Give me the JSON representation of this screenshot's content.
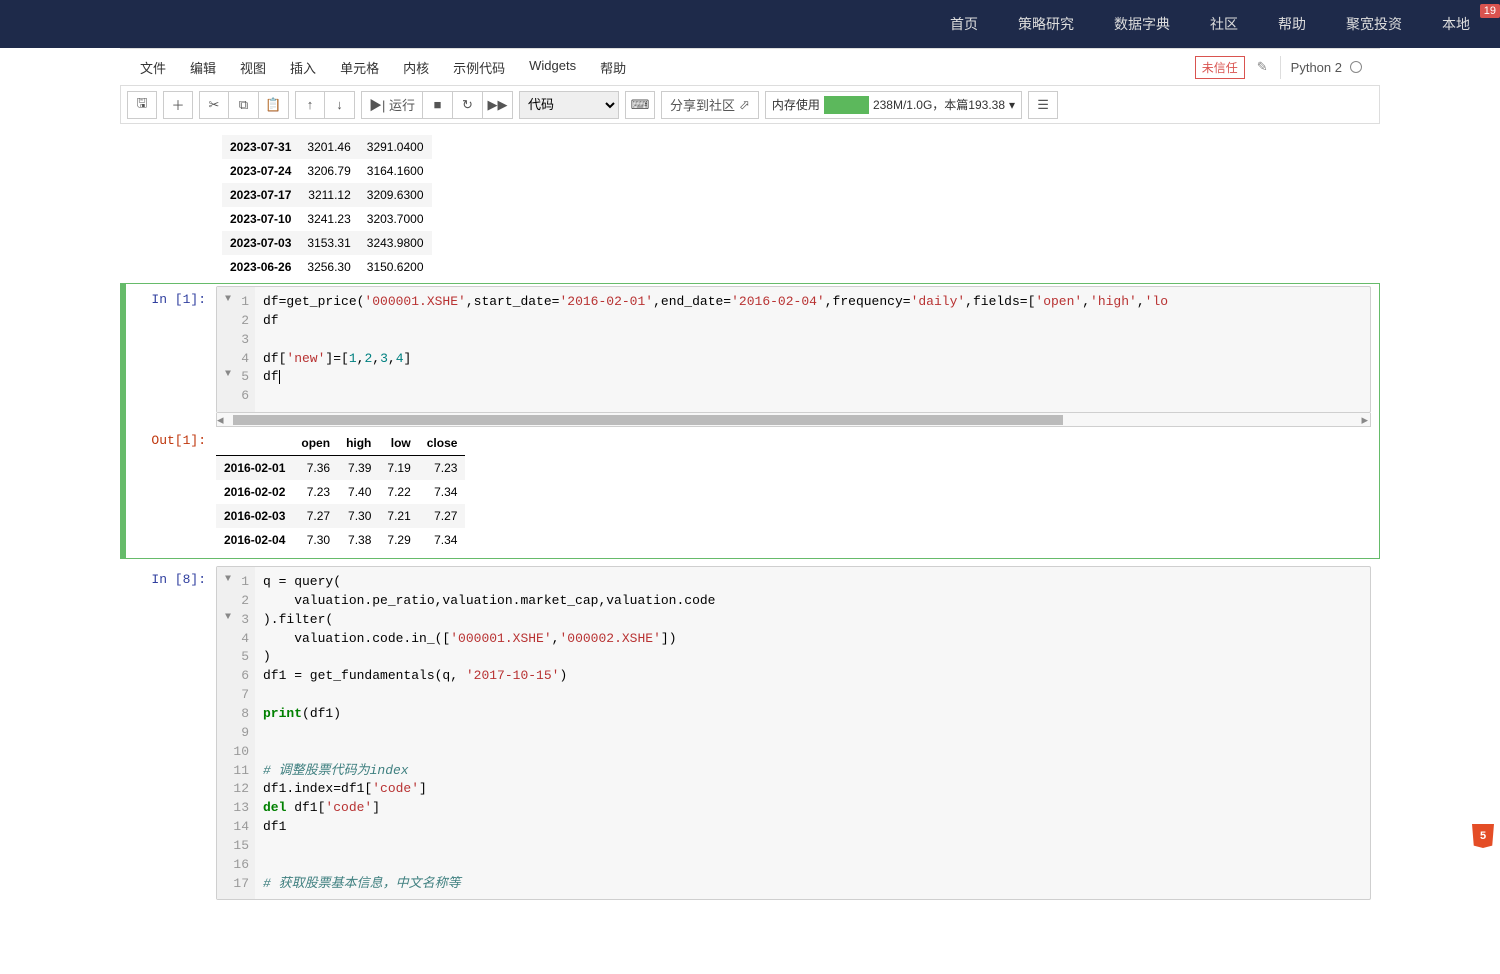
{
  "topnav": {
    "items": [
      "首页",
      "策略研究",
      "数据字典",
      "社区",
      "帮助",
      "聚宽投资",
      "本地"
    ],
    "notification_count": "19"
  },
  "menubar": {
    "items": [
      "文件",
      "编辑",
      "视图",
      "插入",
      "单元格",
      "内核",
      "示例代码",
      "Widgets",
      "帮助"
    ],
    "trust": "未信任",
    "kernel": "Python 2"
  },
  "toolbar": {
    "run_label": "▶| 运行",
    "share_label": "分享到社区",
    "cell_type": "代码",
    "mem_label": "内存使用",
    "mem_text": "238M/1.0G，本篇193.38",
    "save_title": "保存",
    "add_title": "新增",
    "cut_title": "剪切",
    "copy_title": "复制",
    "paste_title": "粘贴",
    "up_title": "上移",
    "down_title": "下移",
    "stop_title": "停止",
    "restart_title": "重启",
    "ff_title": "快进"
  },
  "cell0_out_rows": [
    {
      "d": "2023-07-31",
      "a": "3201.46",
      "b": "3291.0400"
    },
    {
      "d": "2023-07-24",
      "a": "3206.79",
      "b": "3164.1600"
    },
    {
      "d": "2023-07-17",
      "a": "3211.12",
      "b": "3209.6300"
    },
    {
      "d": "2023-07-10",
      "a": "3241.23",
      "b": "3203.7000"
    },
    {
      "d": "2023-07-03",
      "a": "3153.31",
      "b": "3243.9800"
    },
    {
      "d": "2023-06-26",
      "a": "3256.30",
      "b": "3150.6200"
    }
  ],
  "cell1": {
    "in_prompt": "In  [1]:",
    "out_prompt": "Out[1]:",
    "code_lines": [
      "1",
      "2",
      "3",
      "4",
      "5",
      "6"
    ],
    "code_html": "df=get_price(<span class='tok-str'>'000001.XSHE'</span>,start_date=<span class='tok-str'>'2016-02-01'</span>,end_date=<span class='tok-str'>'2016-02-04'</span>,frequency=<span class='tok-str'>'daily'</span>,fields=[<span class='tok-str'>'open'</span>,<span class='tok-str'>'high'</span>,<span class='tok-str'>'lo</span>\ndf\n\ndf[<span class='tok-str'>'new'</span>]=[<span class='tok-num'>1</span>,<span class='tok-num'>2</span>,<span class='tok-num'>3</span>,<span class='tok-num'>4</span>]\ndf<span class='cursor-bar'></span>",
    "headers": [
      "",
      "open",
      "high",
      "low",
      "close"
    ],
    "rows": [
      {
        "d": "2016-02-01",
        "open": "7.36",
        "high": "7.39",
        "low": "7.19",
        "close": "7.23"
      },
      {
        "d": "2016-02-02",
        "open": "7.23",
        "high": "7.40",
        "low": "7.22",
        "close": "7.34"
      },
      {
        "d": "2016-02-03",
        "open": "7.27",
        "high": "7.30",
        "low": "7.21",
        "close": "7.27"
      },
      {
        "d": "2016-02-04",
        "open": "7.30",
        "high": "7.38",
        "low": "7.29",
        "close": "7.34"
      }
    ]
  },
  "cell2": {
    "in_prompt": "In  [8]:",
    "code_lines": [
      "1",
      "2",
      "3",
      "4",
      "5",
      "6",
      "7",
      "8",
      "9",
      "10",
      "11",
      "12",
      "13",
      "14",
      "15",
      "16",
      "17"
    ],
    "code_html": "q = query(\n    valuation.pe_ratio,valuation.market_cap,valuation.code\n).filter(\n    valuation.code.in_([<span class='tok-str'>'000001.XSHE'</span>,<span class='tok-str'>'000002.XSHE'</span>])\n)\ndf1 = get_fundamentals(q, <span class='tok-str'>'2017-10-15'</span>)\n\n<span class='tok-kw'>print</span>(df1)\n\n\n<span class='tok-comment'># 调整股票代码为index</span>\ndf1.index=df1[<span class='tok-str'>'code'</span>]\n<span class='tok-kw'>del</span> df1[<span class='tok-str'>'code'</span>]\ndf1\n\n\n<span class='tok-comment'># 获取股票基本信息，中文名称等</span>"
  }
}
